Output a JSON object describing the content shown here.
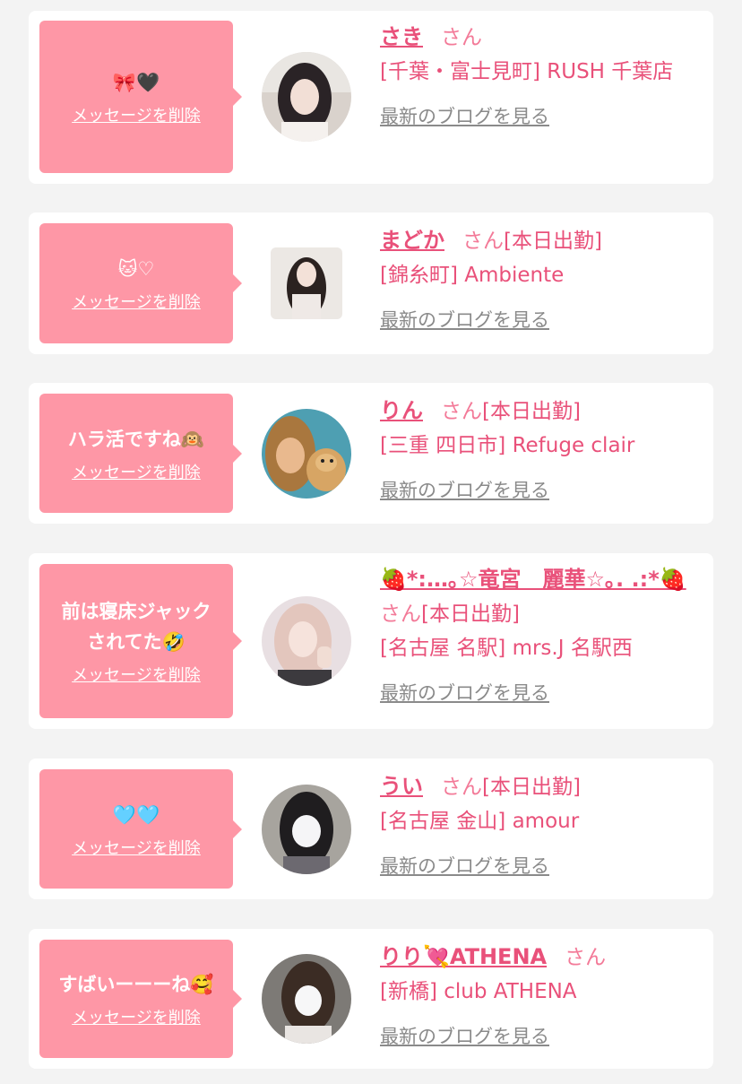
{
  "delete_label": "メッセージを削除",
  "blog_label": "最新のブログを見る",
  "san_label": "さん",
  "today_label": "[本日出勤]",
  "colors": {
    "bubble": "#fe97a6",
    "accent": "#e9517a",
    "link_gray": "#8a8a8a",
    "background": "#f3f3f3"
  },
  "items": [
    {
      "message": "🎀🖤",
      "name": "さき",
      "shop": "[千葉・富士見町] RUSH 千葉店",
      "today": ""
    },
    {
      "message": "🐱♡",
      "name": "まどか",
      "shop": "[錦糸町] Ambiente",
      "today": "[本日出勤]"
    },
    {
      "message": "ハラ活ですね🙉",
      "name": "りん",
      "shop": "[三重 四日市] Refuge clair",
      "today": "[本日出勤]"
    },
    {
      "message": "前は寝床ジャック\nされてた🤣",
      "name": "🍓*:…｡☆竜宮　麗華☆｡. .:*🍓",
      "shop": "[名古屋 名駅] mrs.J 名駅西",
      "today": "[本日出勤]"
    },
    {
      "message": "🩵🩵",
      "name": "うい",
      "shop": "[名古屋 金山] amour",
      "today": "[本日出勤]"
    },
    {
      "message": "すばいーーーね🥰",
      "name": "りり💘ATHENA",
      "shop": "[新橋] club ATHENA",
      "today": ""
    }
  ]
}
